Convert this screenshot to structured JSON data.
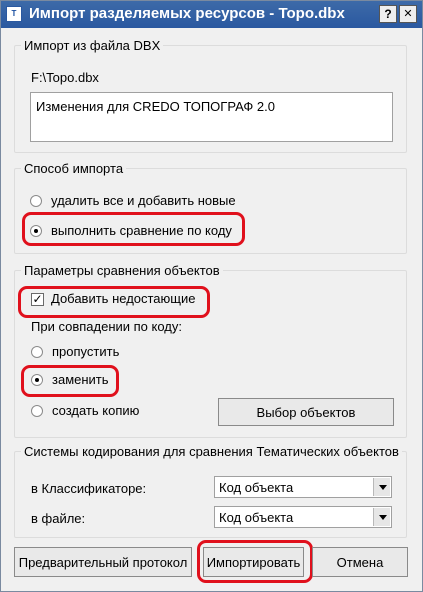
{
  "window": {
    "title": "Импорт разделяемых ресурсов - Topo.dbx",
    "icon_name": "app-icon",
    "icon_text": "T",
    "help_label": "?",
    "close_label": "✕"
  },
  "import_file": {
    "legend": "Импорт из файла DBX",
    "path": "F:\\Topo.dbx",
    "description": "Изменения для CREDO ТОПОГРАФ 2.0"
  },
  "import_mode": {
    "legend": "Способ импорта",
    "options": [
      {
        "label": "удалить все и добавить новые",
        "checked": false
      },
      {
        "label": "выполнить сравнение по коду",
        "checked": true
      }
    ]
  },
  "compare_params": {
    "legend": "Параметры сравнения объектов",
    "add_missing": {
      "label": "Добавить недостающие",
      "checked": true
    },
    "on_match_label": "При совпадении по коду:",
    "options": [
      {
        "label": "пропустить",
        "checked": false
      },
      {
        "label": "заменить",
        "checked": true
      },
      {
        "label": "создать копию",
        "checked": false
      }
    ],
    "select_objects_button": "Выбор объектов"
  },
  "coding_systems": {
    "legend": "Системы кодирования для сравнения Тематических объектов",
    "classifier": {
      "label": "в Классификаторе:",
      "value": "Код объекта"
    },
    "file": {
      "label": "в файле:",
      "value": "Код объекта"
    }
  },
  "footer": {
    "preview_button": "Предварительный протокол",
    "import_button": "Импортировать",
    "cancel_button": "Отмена"
  },
  "colors": {
    "titlebar": "#2a58a0",
    "highlight": "#e0101c",
    "dialog_bg": "#f0f0f0"
  }
}
